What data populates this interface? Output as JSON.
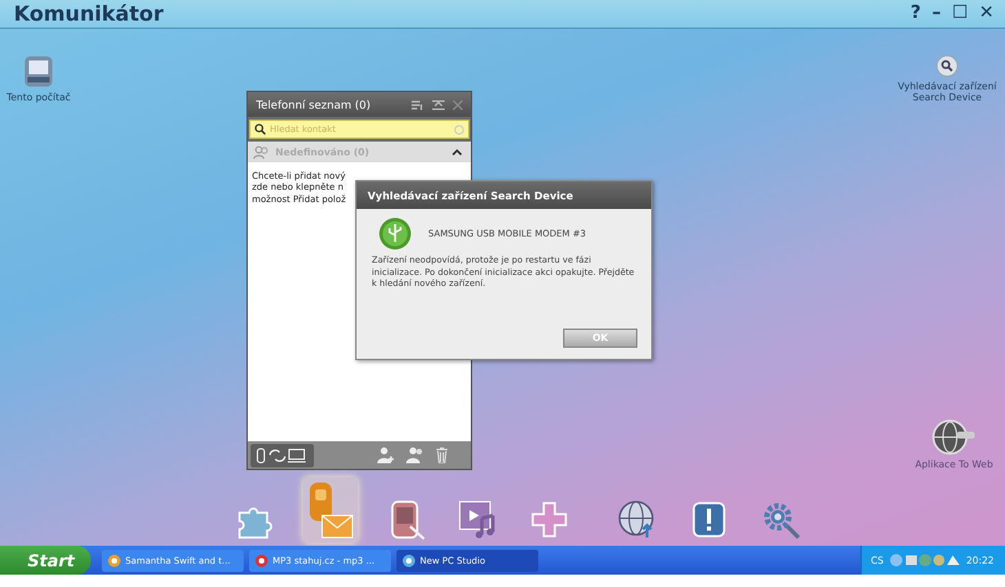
{
  "window": {
    "title": "Komunikátor",
    "controls": [
      "?",
      "–",
      "☐",
      "✕"
    ]
  },
  "desktop_icons": [
    {
      "kind": "computer",
      "label": "Tento počítač"
    },
    {
      "kind": "search",
      "label": "Vyhledávací zařízení Search Device"
    },
    {
      "kind": "web",
      "label": "Aplikace To Web"
    }
  ],
  "contacts_panel": {
    "title": "Telefonní seznam (0)",
    "search": {
      "placeholder": "Hledat kontakt"
    },
    "group": {
      "label": "Nedefinováno (0)",
      "expanded": true
    },
    "hint_lines": [
      "Chcete-li přidat nový",
      "zde nebo klepněte n",
      "možnost Přidat polož"
    ]
  },
  "dialog": {
    "title": "Vyhledávací zařízení Search Device",
    "device": "SAMSUNG USB MOBILE MODEM #3",
    "message": "Zařízení neodpovídá, protože je po restartu ve fázi inicializace. Po dokončení inicializace akci opakujte. Přejděte k hledání nového zařízení.",
    "button": "OK"
  },
  "dock": [
    {
      "kind": "puzzle",
      "selected": false
    },
    {
      "kind": "phone-mail",
      "selected": true
    },
    {
      "kind": "pda",
      "selected": false
    },
    {
      "kind": "media",
      "selected": false
    },
    {
      "kind": "plus",
      "selected": false
    },
    {
      "kind": "globe",
      "selected": false
    },
    {
      "kind": "alert",
      "selected": false
    },
    {
      "kind": "gear",
      "selected": false
    }
  ],
  "taskbar": {
    "start": "Start",
    "items": [
      {
        "label": "Samantha Swift and t...",
        "selected": false
      },
      {
        "label": "MP3 stahuj.cz - mp3 ...",
        "selected": false
      },
      {
        "label": "New PC Studio",
        "selected": true
      }
    ],
    "language": "CS",
    "time": "20:22"
  }
}
